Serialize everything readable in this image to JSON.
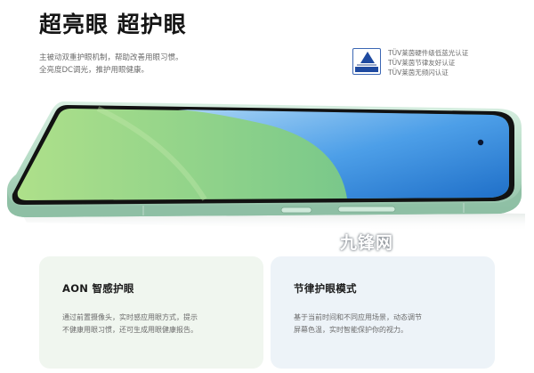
{
  "header": {
    "title": "超亮眼 超护眼",
    "description": [
      "主被动双重护眼机制，帮助改善用眼习惯。",
      "全亮度DC调光，推护用眼健康。"
    ]
  },
  "certification": {
    "badge_icon": "tuv-rheinland-badge-icon",
    "lines": [
      "TÜV莱茵硬件级低蓝光认证",
      "TÜV莱茵节律友好认证",
      "TÜV莱茵无频闪认证"
    ]
  },
  "watermark": "九锋网",
  "cards": [
    {
      "title": "AON 智感护眼",
      "text": [
        "通过前置摄像头，实时感应用眼方式，提示",
        "不健康用眼习惯，还可生成用眼健康报告。"
      ]
    },
    {
      "title": "节律护眼模式",
      "text": [
        "基于当前时间和不同应用场景，动态调节",
        "屏幕色温，实时智能保护你的视力。"
      ]
    }
  ],
  "colors": {
    "frame_green": "#a9d3bc",
    "screen_green": "#9ccf8a",
    "screen_blue": "#4a9be6"
  }
}
